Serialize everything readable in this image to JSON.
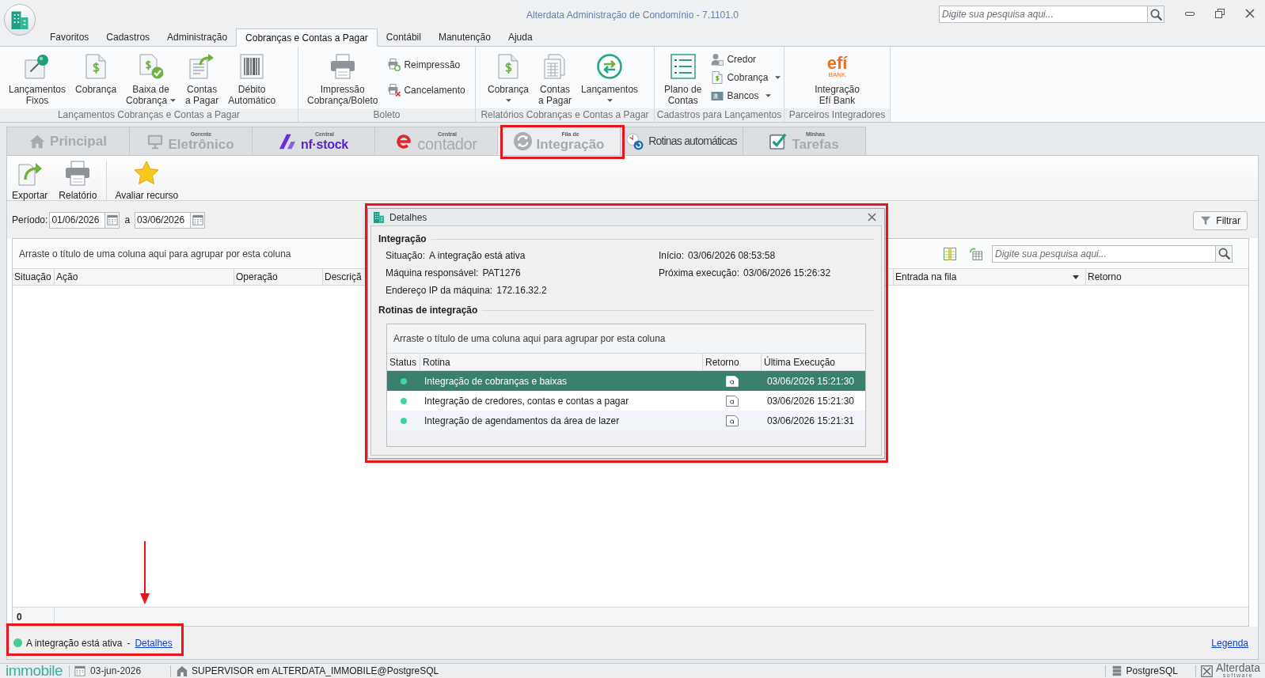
{
  "window": {
    "title": "Alterdata Administração de Condomínio - 7.1101.0",
    "search_placeholder": "Digite sua pesquisa aqui..."
  },
  "menu_tabs": [
    {
      "label": "Favoritos",
      "selected": false
    },
    {
      "label": "Cadastros",
      "selected": false
    },
    {
      "label": "Administração",
      "selected": false
    },
    {
      "label": "Cobranças e Contas a Pagar",
      "selected": true
    },
    {
      "label": "Contábil",
      "selected": false
    },
    {
      "label": "Manutenção",
      "selected": false
    },
    {
      "label": "Ajuda",
      "selected": false
    }
  ],
  "ribbon": {
    "groups": [
      {
        "label": "Lançamentos Cobranças e Contas a Pagar",
        "items": [
          {
            "kind": "large",
            "lines": [
              "Lançamentos",
              "Fixos"
            ],
            "dropdown": false
          },
          {
            "kind": "large",
            "lines": [
              "Cobrança"
            ],
            "dropdown": false
          },
          {
            "kind": "large",
            "lines": [
              "Baixa de",
              "Cobrança"
            ],
            "dropdown": true
          },
          {
            "kind": "large",
            "lines": [
              "Contas",
              "a Pagar"
            ],
            "dropdown": false
          },
          {
            "kind": "large",
            "lines": [
              "Débito",
              "Automático"
            ],
            "dropdown": false
          }
        ]
      },
      {
        "label": "Boleto",
        "items": [
          {
            "kind": "large",
            "lines": [
              "Impressão",
              "Cobrança/Boleto"
            ],
            "dropdown": false
          },
          {
            "kind": "small",
            "lines": [
              "Reimpressão"
            ],
            "dropdown": false
          },
          {
            "kind": "small",
            "lines": [
              "Cancelamento"
            ],
            "dropdown": false
          }
        ]
      },
      {
        "label": "Relatórios Cobranças e Contas a Pagar",
        "items": [
          {
            "kind": "large",
            "lines": [
              "Cobrança"
            ],
            "dropdown": true
          },
          {
            "kind": "large",
            "lines": [
              "Contas",
              "a Pagar"
            ],
            "dropdown": false
          },
          {
            "kind": "large",
            "lines": [
              "Lançamentos"
            ],
            "dropdown": true
          }
        ]
      },
      {
        "label": "Cadastros para Lançamentos",
        "items": [
          {
            "kind": "large",
            "lines": [
              "Plano de",
              "Contas"
            ],
            "dropdown": false
          },
          {
            "kind": "small",
            "lines": [
              "Credor"
            ],
            "dropdown": false
          },
          {
            "kind": "small",
            "lines": [
              "Cobrança"
            ],
            "dropdown": true
          },
          {
            "kind": "small",
            "lines": [
              "Bancos"
            ],
            "dropdown": true
          }
        ]
      },
      {
        "label": "Parceiros Integradores",
        "items": [
          {
            "kind": "logo",
            "logo_text": "efí",
            "logo_subtext": "BANK",
            "lines": [
              "Integração",
              "Efí Bank"
            ],
            "dropdown": false
          }
        ]
      }
    ]
  },
  "module_tabs": [
    {
      "kind": "home",
      "label": "Principal",
      "selected": false
    },
    {
      "kind": "monitor",
      "caption": "Gerente",
      "label": "Eletrônico",
      "selected": false
    },
    {
      "kind": "nfstock",
      "caption": "Central",
      "label": "nf·stock",
      "selected": false
    },
    {
      "kind": "contador",
      "caption": "Central",
      "label": "contador",
      "selected": false
    },
    {
      "kind": "sync",
      "caption": "Fila de",
      "label": "Integração",
      "selected": true
    },
    {
      "kind": "clock",
      "label": "Rotinas automáticas",
      "selected": false
    },
    {
      "kind": "check",
      "caption": "Minhas",
      "label": "Tarefas",
      "selected": false
    }
  ],
  "toolbar": [
    {
      "label": "Exportar",
      "separator_before": false
    },
    {
      "label": "Relatório",
      "separator_before": false
    },
    {
      "label": "Avaliar recurso",
      "separator_before": true
    }
  ],
  "period": {
    "label": "Período:",
    "from": "01/06/2026",
    "separator": "a",
    "to": "03/06/2026"
  },
  "filter_button": "Filtrar",
  "grid": {
    "group_hint": "Arraste o título de uma coluna aqui para agrupar por esta coluna",
    "search_placeholder": "Digite sua pesquisa aqui...",
    "columns": [
      {
        "label": "Situação",
        "sorted": false
      },
      {
        "label": "Ação",
        "sorted": false
      },
      {
        "label": "Operação",
        "sorted": false
      },
      {
        "label": "Descriçã",
        "sorted": false
      },
      {
        "label": "Entrada na fila",
        "sorted": true
      },
      {
        "label": "Retorno",
        "sorted": false
      }
    ],
    "footer_count": "0"
  },
  "status": {
    "color": "#3ecf95",
    "text": "A integração está ativa",
    "separator": "-",
    "link": "Detalhes",
    "legend_link": "Legenda"
  },
  "status_bar": {
    "brand": "immobile",
    "date": "03-jun-2026",
    "session": "SUPERVISOR em ALTERDATA_IMMOBILE@PostgreSQL",
    "database": "PostgreSQL",
    "vendor": "Alterdata",
    "vendor_tagline": "software"
  },
  "dialog": {
    "title": "Detalhes",
    "integration": {
      "heading": "Integração",
      "left_fields": [
        {
          "label": "Situação:",
          "value": "A integração está ativa"
        },
        {
          "label": "Máquina responsável:",
          "value": "PAT1276"
        },
        {
          "label": "Endereço IP da máquina:",
          "value": "172.16.32.2"
        }
      ],
      "right_fields": [
        {
          "label": "Início:",
          "value": "03/06/2026 08:53:58"
        },
        {
          "label": "Próxima execução:",
          "value": "03/06/2026 15:26:32"
        }
      ]
    },
    "routines": {
      "heading": "Rotinas de integração",
      "group_hint": "Arraste o título de uma coluna aqui para agrupar por esta coluna",
      "columns": [
        "Status",
        "Rotina",
        "Retorno",
        "Última Execução"
      ],
      "rows": [
        {
          "color": "#3fd69d",
          "name": "Integração de cobranças e baixas",
          "last_run": "03/06/2026 15:21:30",
          "selected": true
        },
        {
          "color": "#3fd69d",
          "name": "Integração de credores, contas e contas a pagar",
          "last_run": "03/06/2026 15:21:30",
          "selected": false
        },
        {
          "color": "#3fd69d",
          "name": "Integração de agendamentos da área de lazer",
          "last_run": "03/06/2026 15:21:31",
          "selected": false
        }
      ]
    }
  }
}
